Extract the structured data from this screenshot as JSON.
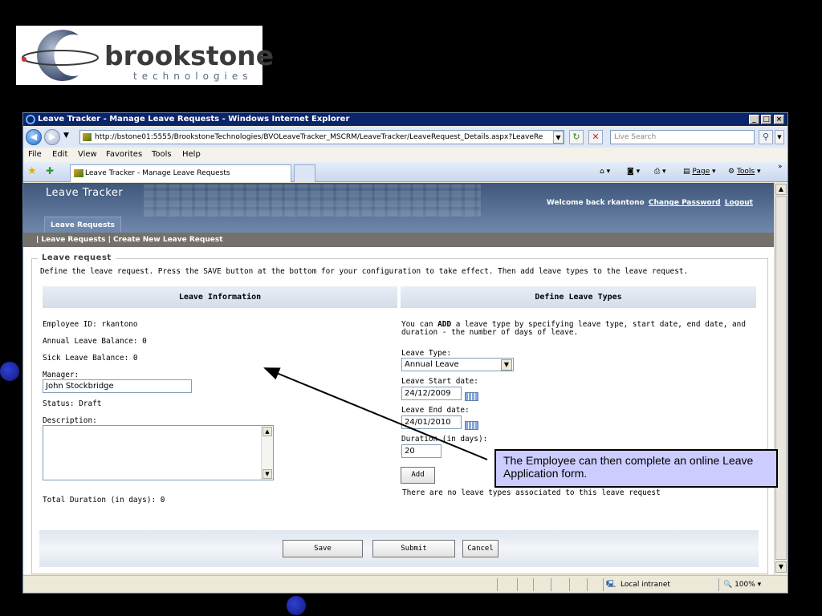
{
  "logo": {
    "word": "brookstone",
    "sub": "technologies"
  },
  "browser": {
    "title": "Leave Tracker - Manage Leave Requests - Windows Internet Explorer",
    "url": "http://bstone01:5555/BrookstoneTechnologies/BVOLeaveTracker_MSCRM/LeaveTracker/LeaveRequest_Details.aspx?LeaveRe",
    "search_placeholder": "Live Search",
    "menu": [
      "File",
      "Edit",
      "View",
      "Favorites",
      "Tools",
      "Help"
    ],
    "tab_label": "Leave Tracker - Manage Leave Requests",
    "cmd_page": "Page",
    "cmd_tools": "Tools",
    "status_zone": "Local intranet",
    "zoom": "100%"
  },
  "app": {
    "title": "Leave Tracker",
    "welcome": "Welcome back rkantono",
    "change_password": "Change Password",
    "logout": "Logout",
    "tab": "Leave Requests",
    "subnav": "| Leave Requests | Create New Leave Request"
  },
  "form": {
    "legend": "Leave request",
    "intro": "Define the leave request. Press the SAVE button at the bottom for your configuration to take effect. Then add leave types to the leave request.",
    "left_header": "Leave Information",
    "right_header": "Define Leave Types",
    "employee_id": "Employee ID: rkantono",
    "annual_balance": "Annual Leave Balance: 0",
    "sick_balance": "Sick Leave Balance: 0",
    "manager_label": "Manager:",
    "manager_value": "John Stockbridge",
    "status": "Status: Draft",
    "description_label": "Description:",
    "total_duration": "Total Duration (in days): 0",
    "right_intro_pre": "You can ",
    "right_intro_bold": "ADD",
    "right_intro_post": " a leave type by specifying leave type, start date, end date, and",
    "right_intro_line2": "duration - the number of days of leave.",
    "leave_type_label": "Leave Type:",
    "leave_type_value": "Annual Leave",
    "start_label": "Leave Start date:",
    "start_value": "24/12/2009",
    "end_label": "Leave End date:",
    "end_value": "24/01/2010",
    "duration_label": "Duration (in days):",
    "duration_value": "20",
    "add_button": "Add",
    "no_types": "There are no leave types associated to this leave request",
    "save": "Save",
    "submit": "Submit",
    "cancel": "Cancel"
  },
  "callout": {
    "text": "The Employee can then complete an online Leave Application form."
  }
}
